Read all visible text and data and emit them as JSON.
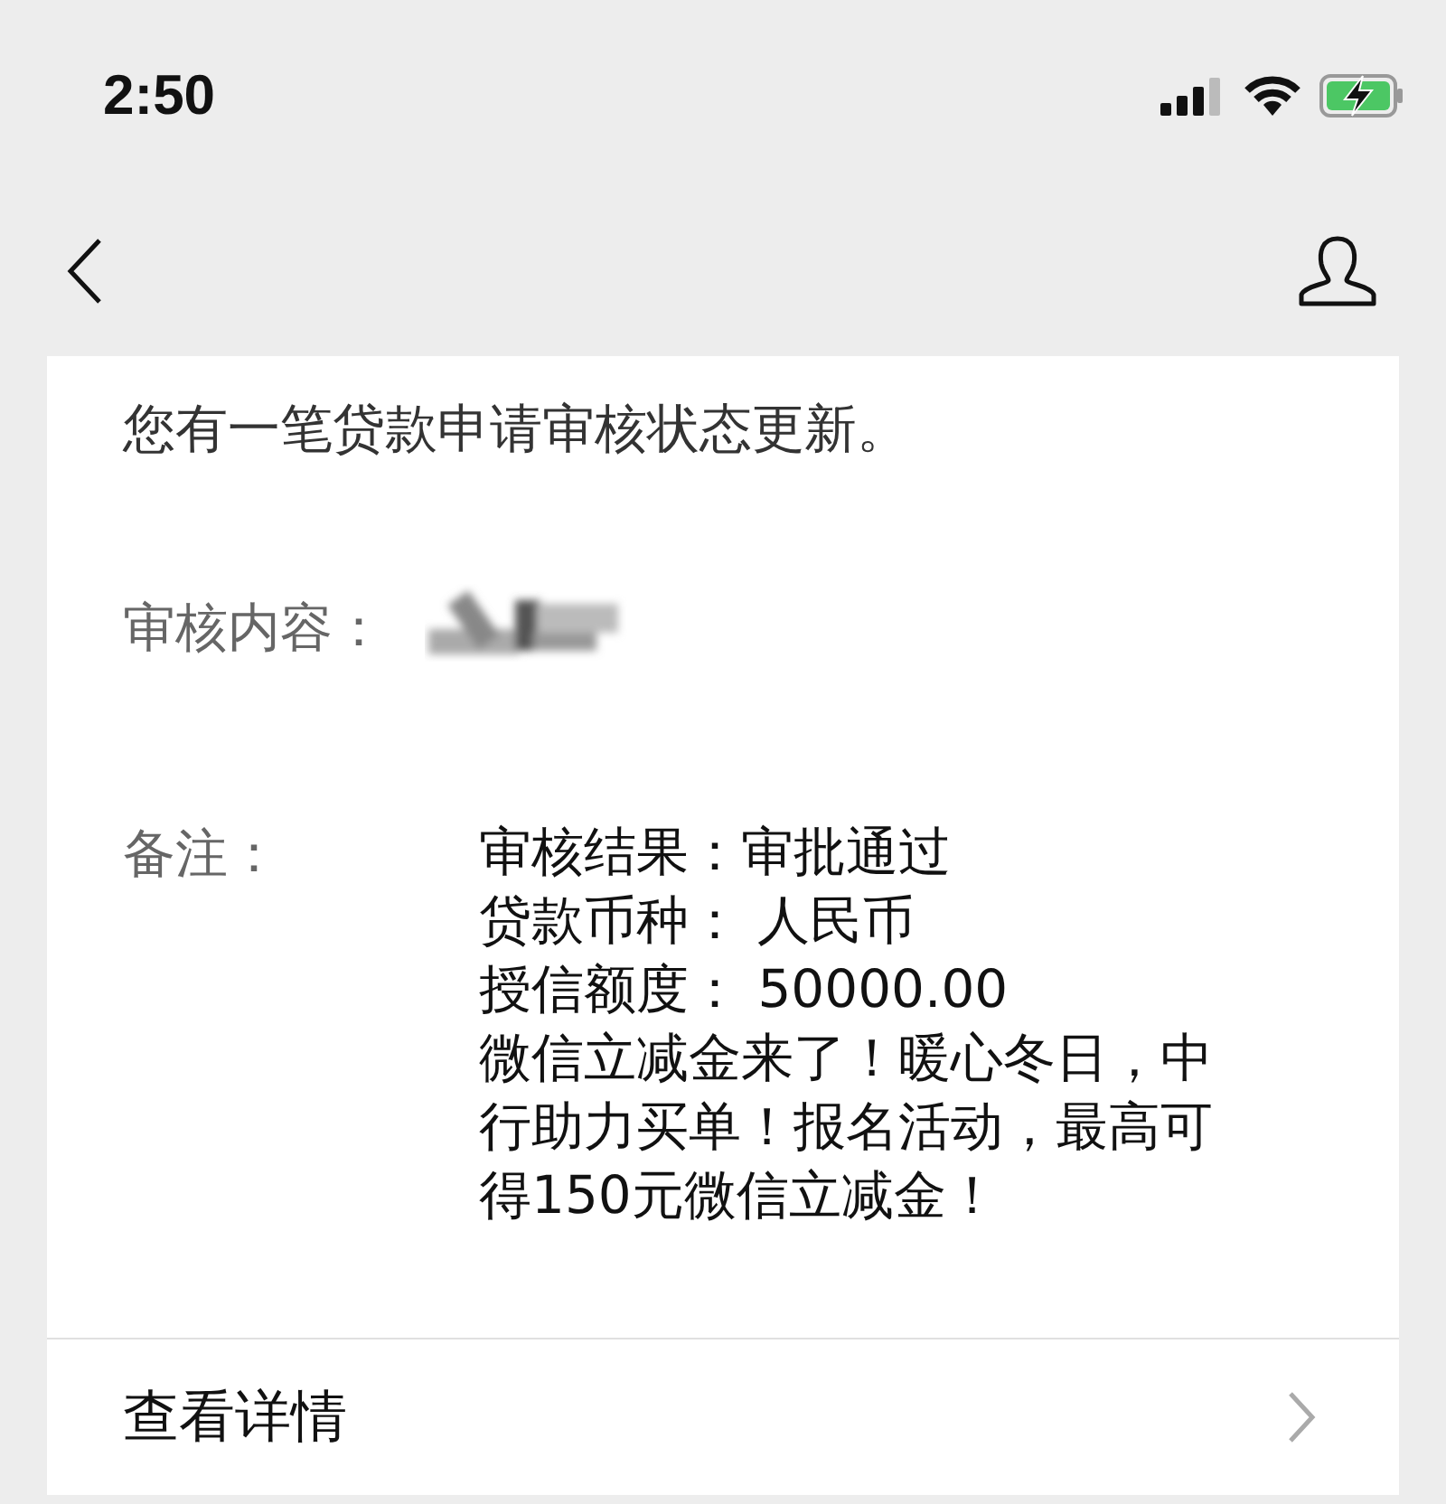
{
  "status_bar": {
    "time": "2:50"
  },
  "message": {
    "intro": "您有一笔贷款申请审核状态更新。",
    "fields": [
      {
        "label": "审核内容：",
        "kind": "redacted"
      },
      {
        "label": "备注：",
        "kind": "lines",
        "lines": [
          "审核结果：审批通过",
          "贷款币种： 人民币",
          "授信额度： 50000.00",
          "微信立减金来了！暖心冬日，中",
          "行助力买单！报名活动，最高可",
          "得150元微信立减金！"
        ]
      }
    ]
  },
  "details_link": {
    "label": "查看详情"
  }
}
